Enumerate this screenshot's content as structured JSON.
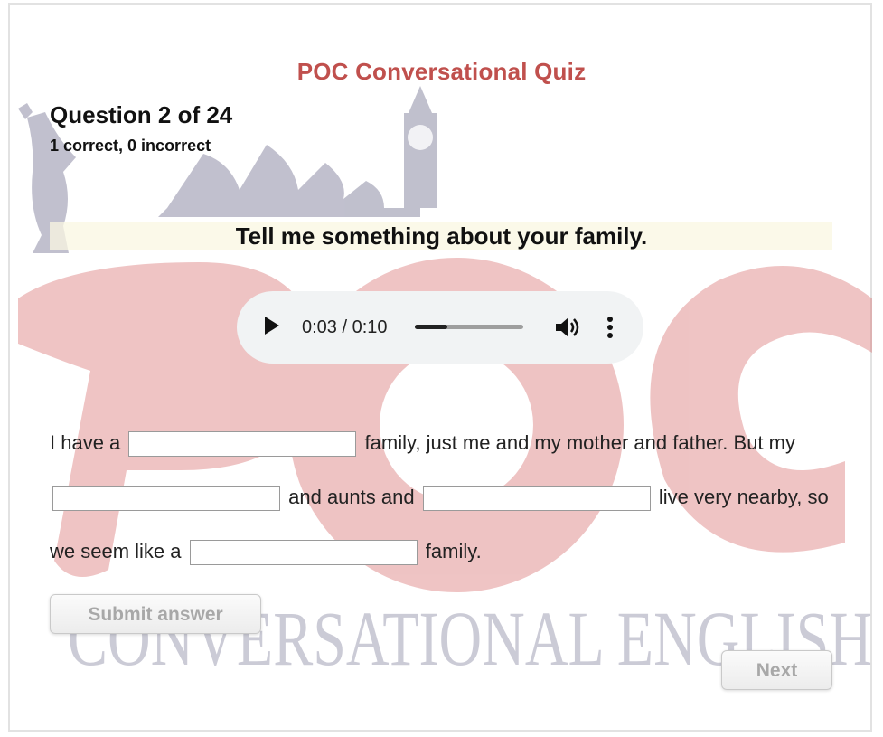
{
  "quiz": {
    "title": "POC Conversational Quiz",
    "question_counter": "Question 2 of 24",
    "score": "1 correct, 0 incorrect",
    "prompt": "Tell me something about your family."
  },
  "audio": {
    "time_display": "0:03 / 0:10",
    "progress": 0.3
  },
  "cloze": {
    "segments": [
      "I have a",
      "family, just me and my mother and father. But my",
      "and aunts and",
      "live very nearby, so we seem like a",
      "family."
    ],
    "blanks": [
      "",
      "",
      "",
      ""
    ]
  },
  "buttons": {
    "submit": "Submit answer",
    "next": "Next"
  },
  "watermark": {
    "logo_text": "POC",
    "tagline": "CONVERSATIONAL ENGLISH"
  },
  "colors": {
    "title": "#c0504d",
    "logo": "#d66b6b",
    "landmarks": "#8e8da6"
  }
}
